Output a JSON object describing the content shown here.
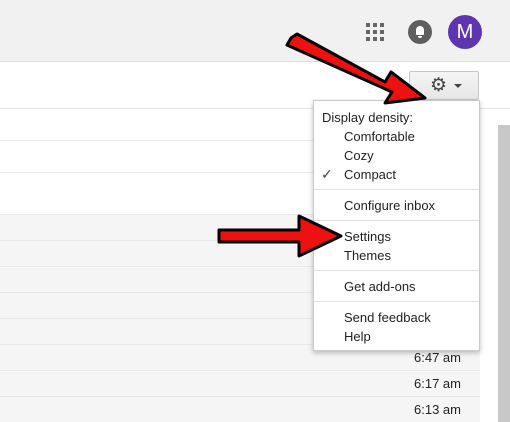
{
  "header": {
    "avatar_letter": "M"
  },
  "settings_menu": {
    "density_heading": "Display density:",
    "density_options": [
      {
        "label": "Comfortable",
        "checked": false
      },
      {
        "label": "Cozy",
        "checked": false
      },
      {
        "label": "Compact",
        "checked": true
      }
    ],
    "configure_inbox": "Configure inbox",
    "settings": "Settings",
    "themes": "Themes",
    "get_addons": "Get add-ons",
    "send_feedback": "Send feedback",
    "help": "Help",
    "checkmark": "✓"
  },
  "mail_list": {
    "times": [
      "6:47 am",
      "6:17 am",
      "6:13 am"
    ]
  },
  "icons": {
    "gear": "⚙"
  },
  "colors": {
    "avatar_bg": "#5e35b1",
    "arrow_red": "#ee1111",
    "arrow_outline": "#000000"
  }
}
